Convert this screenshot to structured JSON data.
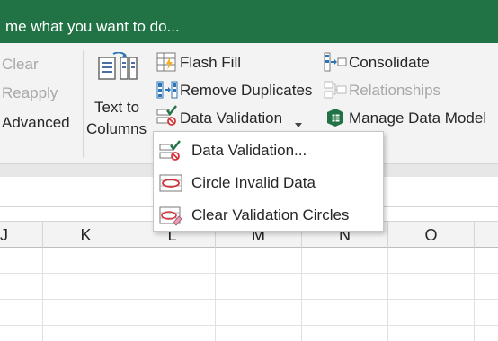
{
  "tellme": {
    "text": "me what you want to do..."
  },
  "ribbon": {
    "sort_filter": {
      "clear": "Clear",
      "reapply": "Reapply",
      "advanced": "Advanced"
    },
    "text_to_columns": {
      "line1": "Text to",
      "line2": "Columns"
    },
    "flash_fill": "Flash Fill",
    "remove_duplicates": "Remove Duplicates",
    "data_validation": "Data Validation",
    "consolidate": "Consolidate",
    "relationships": "Relationships",
    "manage_data_model": "Manage Data Model"
  },
  "dropdown": {
    "items": [
      {
        "label": "Data Validation...",
        "icon": "data-validation-icon"
      },
      {
        "label": "Circle Invalid Data",
        "icon": "circle-invalid-data-icon"
      },
      {
        "label": "Clear Validation Circles",
        "icon": "clear-validation-circles-icon"
      }
    ]
  },
  "columns": [
    "J",
    "K",
    "L",
    "M",
    "N",
    "O"
  ],
  "colors": {
    "title_bar": "#217346",
    "ribbon_bg": "#f3f3f3",
    "dropdown_button_bg": "#c6c6c6",
    "accent_green": "#217346"
  }
}
